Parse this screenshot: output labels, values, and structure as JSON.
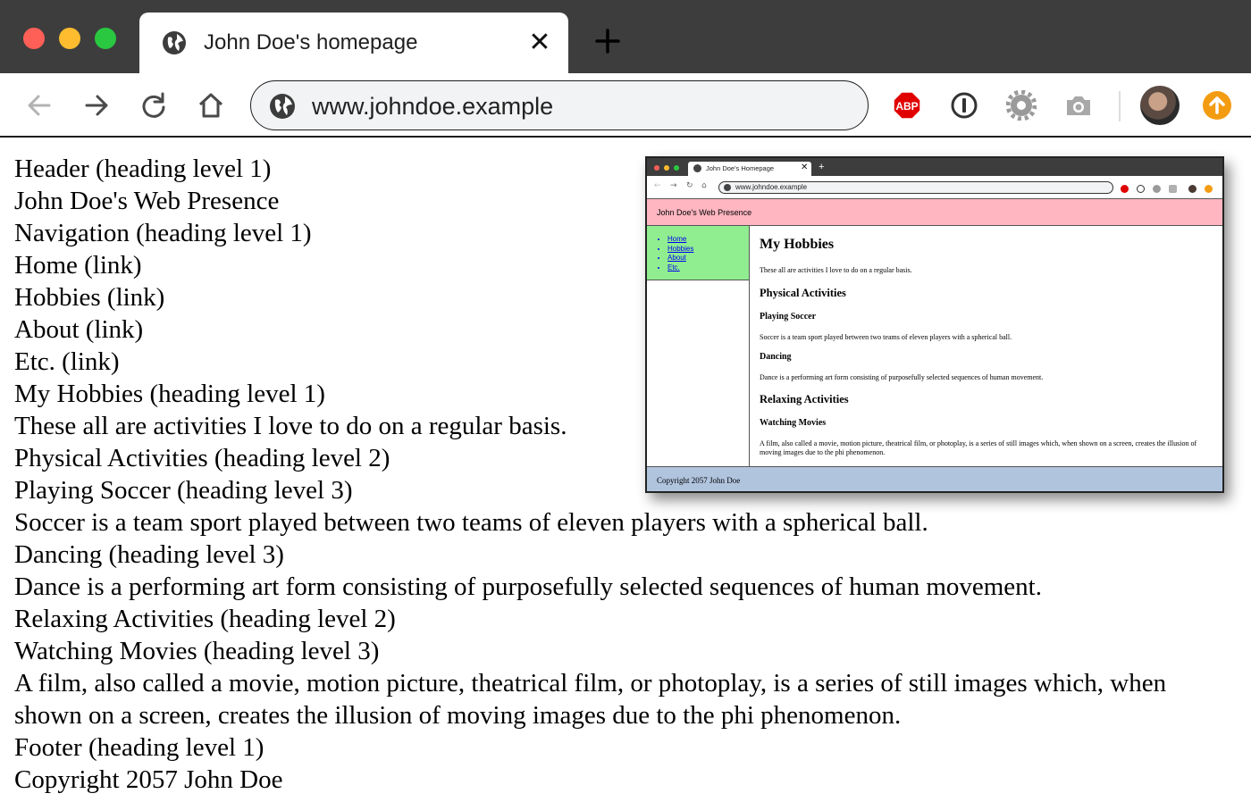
{
  "browser": {
    "tab_title": "John Doe's homepage",
    "tab_close_symbol": "✕",
    "url": "www.johndoe.example",
    "adblock_label": "ABP",
    "icons": [
      "globe-icon",
      "close-icon",
      "plus-icon",
      "back-arrow-icon",
      "forward-arrow-icon",
      "reload-icon",
      "home-icon",
      "adblock-plus-icon",
      "password-manager-icon",
      "settings-gear-icon",
      "camera-icon",
      "avatar",
      "update-icon"
    ],
    "colors": {
      "close": "#fe5f57",
      "minimize": "#febc2e",
      "maximize": "#29c840",
      "adblock": "#e00000",
      "update": "#f39c12"
    }
  },
  "page": {
    "lines": [
      "Header (heading level 1)",
      "John Doe's Web Presence",
      "Navigation (heading level 1)",
      "Home (link)",
      "Hobbies (link)",
      "About (link)",
      "Etc. (link)",
      "My Hobbies (heading level 1)",
      "These all are activities I love to do on a regular basis.",
      "Physical Activities (heading level 2)",
      "Playing Soccer (heading level 3)",
      "Soccer is a team sport played between two teams of eleven players with a spherical ball.",
      "Dancing (heading level 3)",
      "Dance is a performing art form consisting of purposefully selected sequences of human movement.",
      "Relaxing Activities (heading level 2)",
      "Watching Movies (heading level 3)",
      "A film, also called a movie, motion picture, theatrical film, or photoplay, is a series of still images which, when shown on a screen, creates the illusion of moving images due to the phi phenomenon.",
      "Footer (heading level 1)",
      "Copyright 2057 John Doe"
    ]
  },
  "preview": {
    "tab_title": "John Doe's Homepage",
    "url": "www.johndoe.example",
    "header": "John Doe's Web Presence",
    "nav": [
      "Home",
      "Hobbies",
      "About",
      "Etc."
    ],
    "main": {
      "h1": "My Hobbies",
      "intro": "These all are activities I love to do on a regular basis.",
      "physical_h2": "Physical Activities",
      "soccer_h3": "Playing Soccer",
      "soccer_p": "Soccer is a team sport played between two teams of eleven players with a spherical ball.",
      "dancing_h3": "Dancing",
      "dancing_p": "Dance is a performing art form consisting of purposefully selected sequences of human movement.",
      "relaxing_h2": "Relaxing Activities",
      "movies_h3": "Watching Movies",
      "movies_p": "A film, also called a movie, motion picture, theatrical film, or photoplay, is a series of still images which, when shown on a screen, creates the illusion of moving images due to the phi phenomenon."
    },
    "footer": "Copyright 2057 John Doe",
    "colors": {
      "header_bg": "#ffb6c1",
      "nav_bg": "#90ee90",
      "footer_bg": "#b0c4de"
    }
  }
}
